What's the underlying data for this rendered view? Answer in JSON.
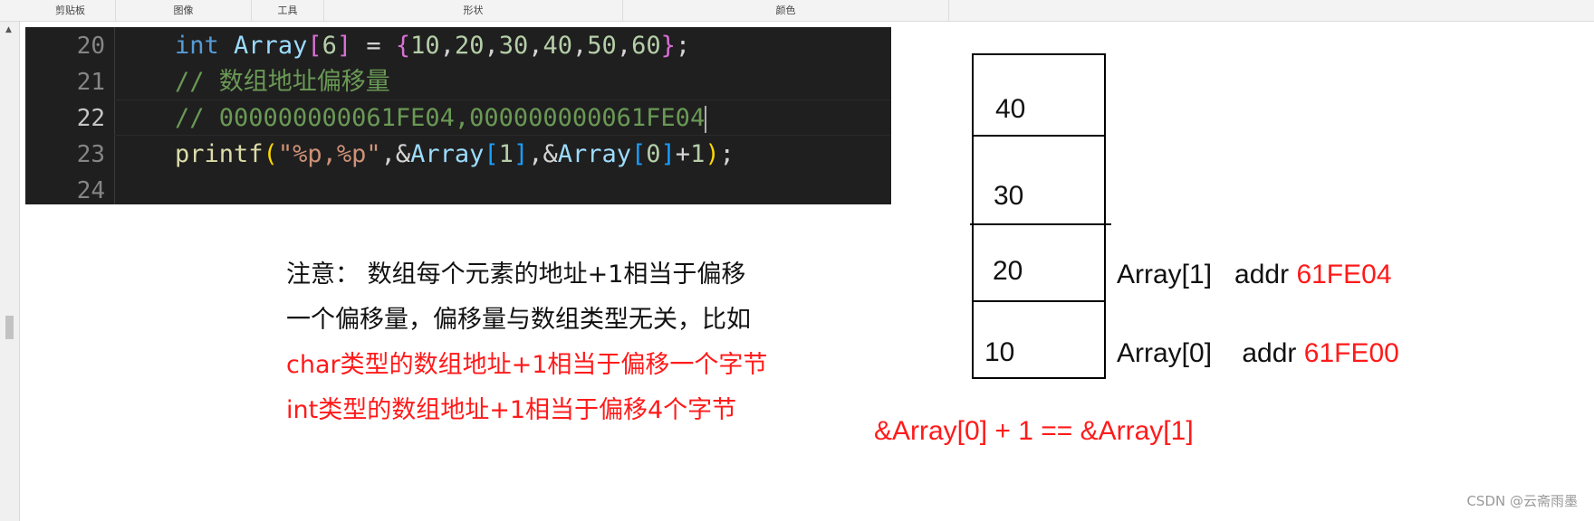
{
  "ribbon": {
    "groups": [
      "剪贴板",
      "图像",
      "工具",
      "形状",
      "颜色"
    ]
  },
  "editor": {
    "lines": [
      {
        "number": "20",
        "tokens": [
          {
            "t": "int",
            "c": "kw"
          },
          {
            "t": " ",
            "c": ""
          },
          {
            "t": "Array",
            "c": "var"
          },
          {
            "t": "[",
            "c": "brk1"
          },
          {
            "t": "6",
            "c": "num"
          },
          {
            "t": "]",
            "c": "brk1"
          },
          {
            "t": " = ",
            "c": ""
          },
          {
            "t": "{",
            "c": "brk1"
          },
          {
            "t": "10",
            "c": "num"
          },
          {
            "t": ",",
            "c": ""
          },
          {
            "t": "20",
            "c": "num"
          },
          {
            "t": ",",
            "c": ""
          },
          {
            "t": "30",
            "c": "num"
          },
          {
            "t": ",",
            "c": ""
          },
          {
            "t": "40",
            "c": "num"
          },
          {
            "t": ",",
            "c": ""
          },
          {
            "t": "50",
            "c": "num"
          },
          {
            "t": ",",
            "c": ""
          },
          {
            "t": "60",
            "c": "num"
          },
          {
            "t": "}",
            "c": "brk1"
          },
          {
            "t": ";",
            "c": ""
          }
        ]
      },
      {
        "number": "21",
        "tokens": [
          {
            "t": "// 数组地址偏移量",
            "c": "cmt"
          }
        ]
      },
      {
        "number": "22",
        "active": true,
        "tokens": [
          {
            "t": "// 000000000061FE04,000000000061FE04",
            "c": "cmt"
          }
        ]
      },
      {
        "number": "23",
        "tokens": [
          {
            "t": "printf",
            "c": "fn"
          },
          {
            "t": "(",
            "c": "brk3"
          },
          {
            "t": "\"%p,%p\"",
            "c": "str"
          },
          {
            "t": ",&",
            "c": ""
          },
          {
            "t": "Array",
            "c": "var"
          },
          {
            "t": "[",
            "c": "brk2"
          },
          {
            "t": "1",
            "c": "num"
          },
          {
            "t": "]",
            "c": "brk2"
          },
          {
            "t": ",&",
            "c": ""
          },
          {
            "t": "Array",
            "c": "var"
          },
          {
            "t": "[",
            "c": "brk2"
          },
          {
            "t": "0",
            "c": "num"
          },
          {
            "t": "]",
            "c": "brk2"
          },
          {
            "t": "+",
            "c": ""
          },
          {
            "t": "1",
            "c": "num"
          },
          {
            "t": ")",
            "c": "brk3"
          },
          {
            "t": ";",
            "c": ""
          }
        ]
      },
      {
        "number": "24",
        "tokens": []
      }
    ]
  },
  "note": {
    "line1": "注意： 数组每个元素的地址+1相当于偏移",
    "line2": "一个偏移量，偏移量与数组类型无关，比如",
    "line3": "char类型的数组地址+1相当于偏移一个字节",
    "line4": "int类型的数组地址+1相当于偏移4个字节"
  },
  "memory": {
    "cells": [
      "40",
      "30",
      "20",
      "10"
    ],
    "addr1_label": "Array[1]",
    "addr1_word": "addr",
    "addr1_hex": "61FE04",
    "addr0_label": "Array[0]",
    "addr0_word": "addr",
    "addr0_hex": "61FE00",
    "formula": "&Array[0] + 1 == &Array[1]"
  },
  "watermark": "CSDN @云斋雨墨",
  "colors": {
    "highlight_red": "#ff1a1a",
    "editor_bg": "#1f1f1f",
    "comment": "#6a9955",
    "keyword": "#569cd6"
  }
}
